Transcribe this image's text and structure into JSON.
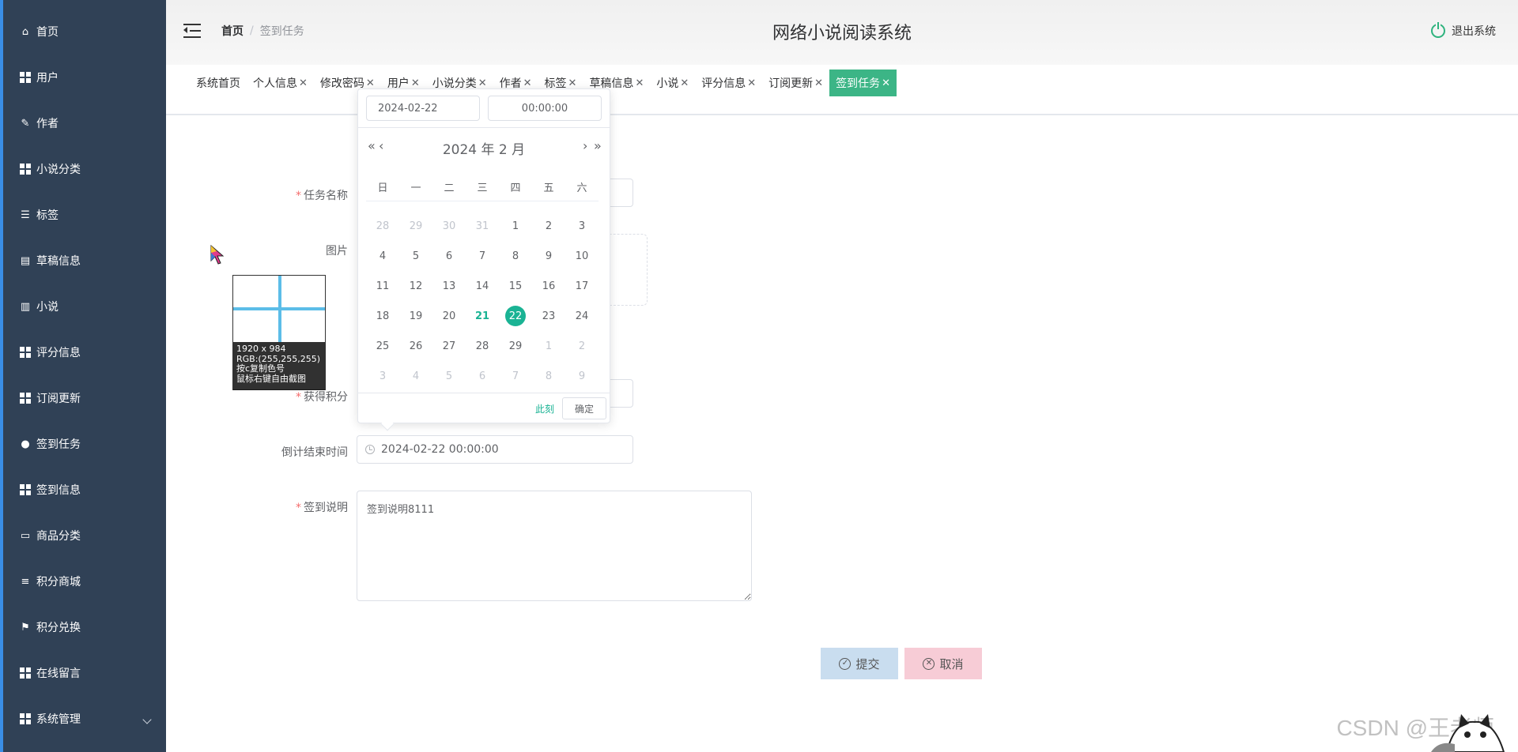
{
  "sidebar": {
    "items": [
      {
        "label": "首页",
        "icon": "home-icon"
      },
      {
        "label": "用户",
        "icon": "grid-icon"
      },
      {
        "label": "作者",
        "icon": "edit-icon"
      },
      {
        "label": "小说分类",
        "icon": "grid-icon"
      },
      {
        "label": "标签",
        "icon": "sliders-icon"
      },
      {
        "label": "草稿信息",
        "icon": "clipboard-icon"
      },
      {
        "label": "小说",
        "icon": "books-icon"
      },
      {
        "label": "评分信息",
        "icon": "grid-icon"
      },
      {
        "label": "订阅更新",
        "icon": "grid-icon"
      },
      {
        "label": "签到任务",
        "icon": "user-icon"
      },
      {
        "label": "签到信息",
        "icon": "grid-icon"
      },
      {
        "label": "商品分类",
        "icon": "comment-icon"
      },
      {
        "label": "积分商城",
        "icon": "list-icon"
      },
      {
        "label": "积分兑换",
        "icon": "flag-icon"
      },
      {
        "label": "在线留言",
        "icon": "grid-icon"
      },
      {
        "label": "系统管理",
        "icon": "grid-icon"
      }
    ]
  },
  "header": {
    "breadcrumb_home": "首页",
    "breadcrumb_sep": "/",
    "breadcrumb_current": "签到任务",
    "title": "网络小说阅读系统",
    "logout": "退出系统"
  },
  "tabs": [
    {
      "label": "系统首页",
      "closable": false
    },
    {
      "label": "个人信息",
      "closable": true
    },
    {
      "label": "修改密码",
      "closable": true
    },
    {
      "label": "用户",
      "closable": true
    },
    {
      "label": "小说分类",
      "closable": true
    },
    {
      "label": "作者",
      "closable": true
    },
    {
      "label": "标签",
      "closable": true
    },
    {
      "label": "草稿信息",
      "closable": true
    },
    {
      "label": "小说",
      "closable": true
    },
    {
      "label": "评分信息",
      "closable": true
    },
    {
      "label": "订阅更新",
      "closable": true
    },
    {
      "label": "签到任务",
      "closable": true,
      "active": true
    }
  ],
  "form": {
    "task_name_label": "任务名称",
    "image_label": "图片",
    "points_label": "获得积分",
    "end_time_label": "倒计结束时间",
    "end_time_value": "2024-02-22 00:00:00",
    "desc_label": "签到说明",
    "desc_value": "签到说明8111",
    "submit": "提交",
    "cancel": "取消"
  },
  "picker": {
    "date_value": "2024-02-22",
    "time_value": "00:00:00",
    "year_month": "2024 年  2 月",
    "nav_prev_year": "«",
    "nav_prev_month": "‹",
    "nav_next_month": "›",
    "nav_next_year": "»",
    "weekdays": [
      "日",
      "一",
      "二",
      "三",
      "四",
      "五",
      "六"
    ],
    "days": [
      {
        "d": "28",
        "s": "dim"
      },
      {
        "d": "29",
        "s": "dim"
      },
      {
        "d": "30",
        "s": "dim"
      },
      {
        "d": "31",
        "s": "dim"
      },
      {
        "d": "1"
      },
      {
        "d": "2"
      },
      {
        "d": "3"
      },
      {
        "d": "4"
      },
      {
        "d": "5"
      },
      {
        "d": "6"
      },
      {
        "d": "7"
      },
      {
        "d": "8"
      },
      {
        "d": "9"
      },
      {
        "d": "10"
      },
      {
        "d": "11"
      },
      {
        "d": "12"
      },
      {
        "d": "13"
      },
      {
        "d": "14"
      },
      {
        "d": "15"
      },
      {
        "d": "16"
      },
      {
        "d": "17"
      },
      {
        "d": "18"
      },
      {
        "d": "19"
      },
      {
        "d": "20"
      },
      {
        "d": "21",
        "s": "today"
      },
      {
        "d": "22",
        "s": "sel"
      },
      {
        "d": "23"
      },
      {
        "d": "24"
      },
      {
        "d": "25"
      },
      {
        "d": "26"
      },
      {
        "d": "27"
      },
      {
        "d": "28"
      },
      {
        "d": "29"
      },
      {
        "d": "1",
        "s": "dim"
      },
      {
        "d": "2",
        "s": "dim"
      },
      {
        "d": "3",
        "s": "dim"
      },
      {
        "d": "4",
        "s": "dim"
      },
      {
        "d": "5",
        "s": "dim"
      },
      {
        "d": "6",
        "s": "dim"
      },
      {
        "d": "7",
        "s": "dim"
      },
      {
        "d": "8",
        "s": "dim"
      },
      {
        "d": "9",
        "s": "dim"
      }
    ],
    "now": "此刻",
    "ok": "确定"
  },
  "magnifier": {
    "line1": "1920 x 984",
    "line2": "RGB:(255,255,255)",
    "line3": "按c复制色号",
    "line4": "鼠标右键自由截图"
  },
  "watermark": "CSDN @王老师",
  "colors": {
    "sidebar_bg": "#304156",
    "accent": "#3cb586",
    "picker_accent": "#1ab394"
  }
}
